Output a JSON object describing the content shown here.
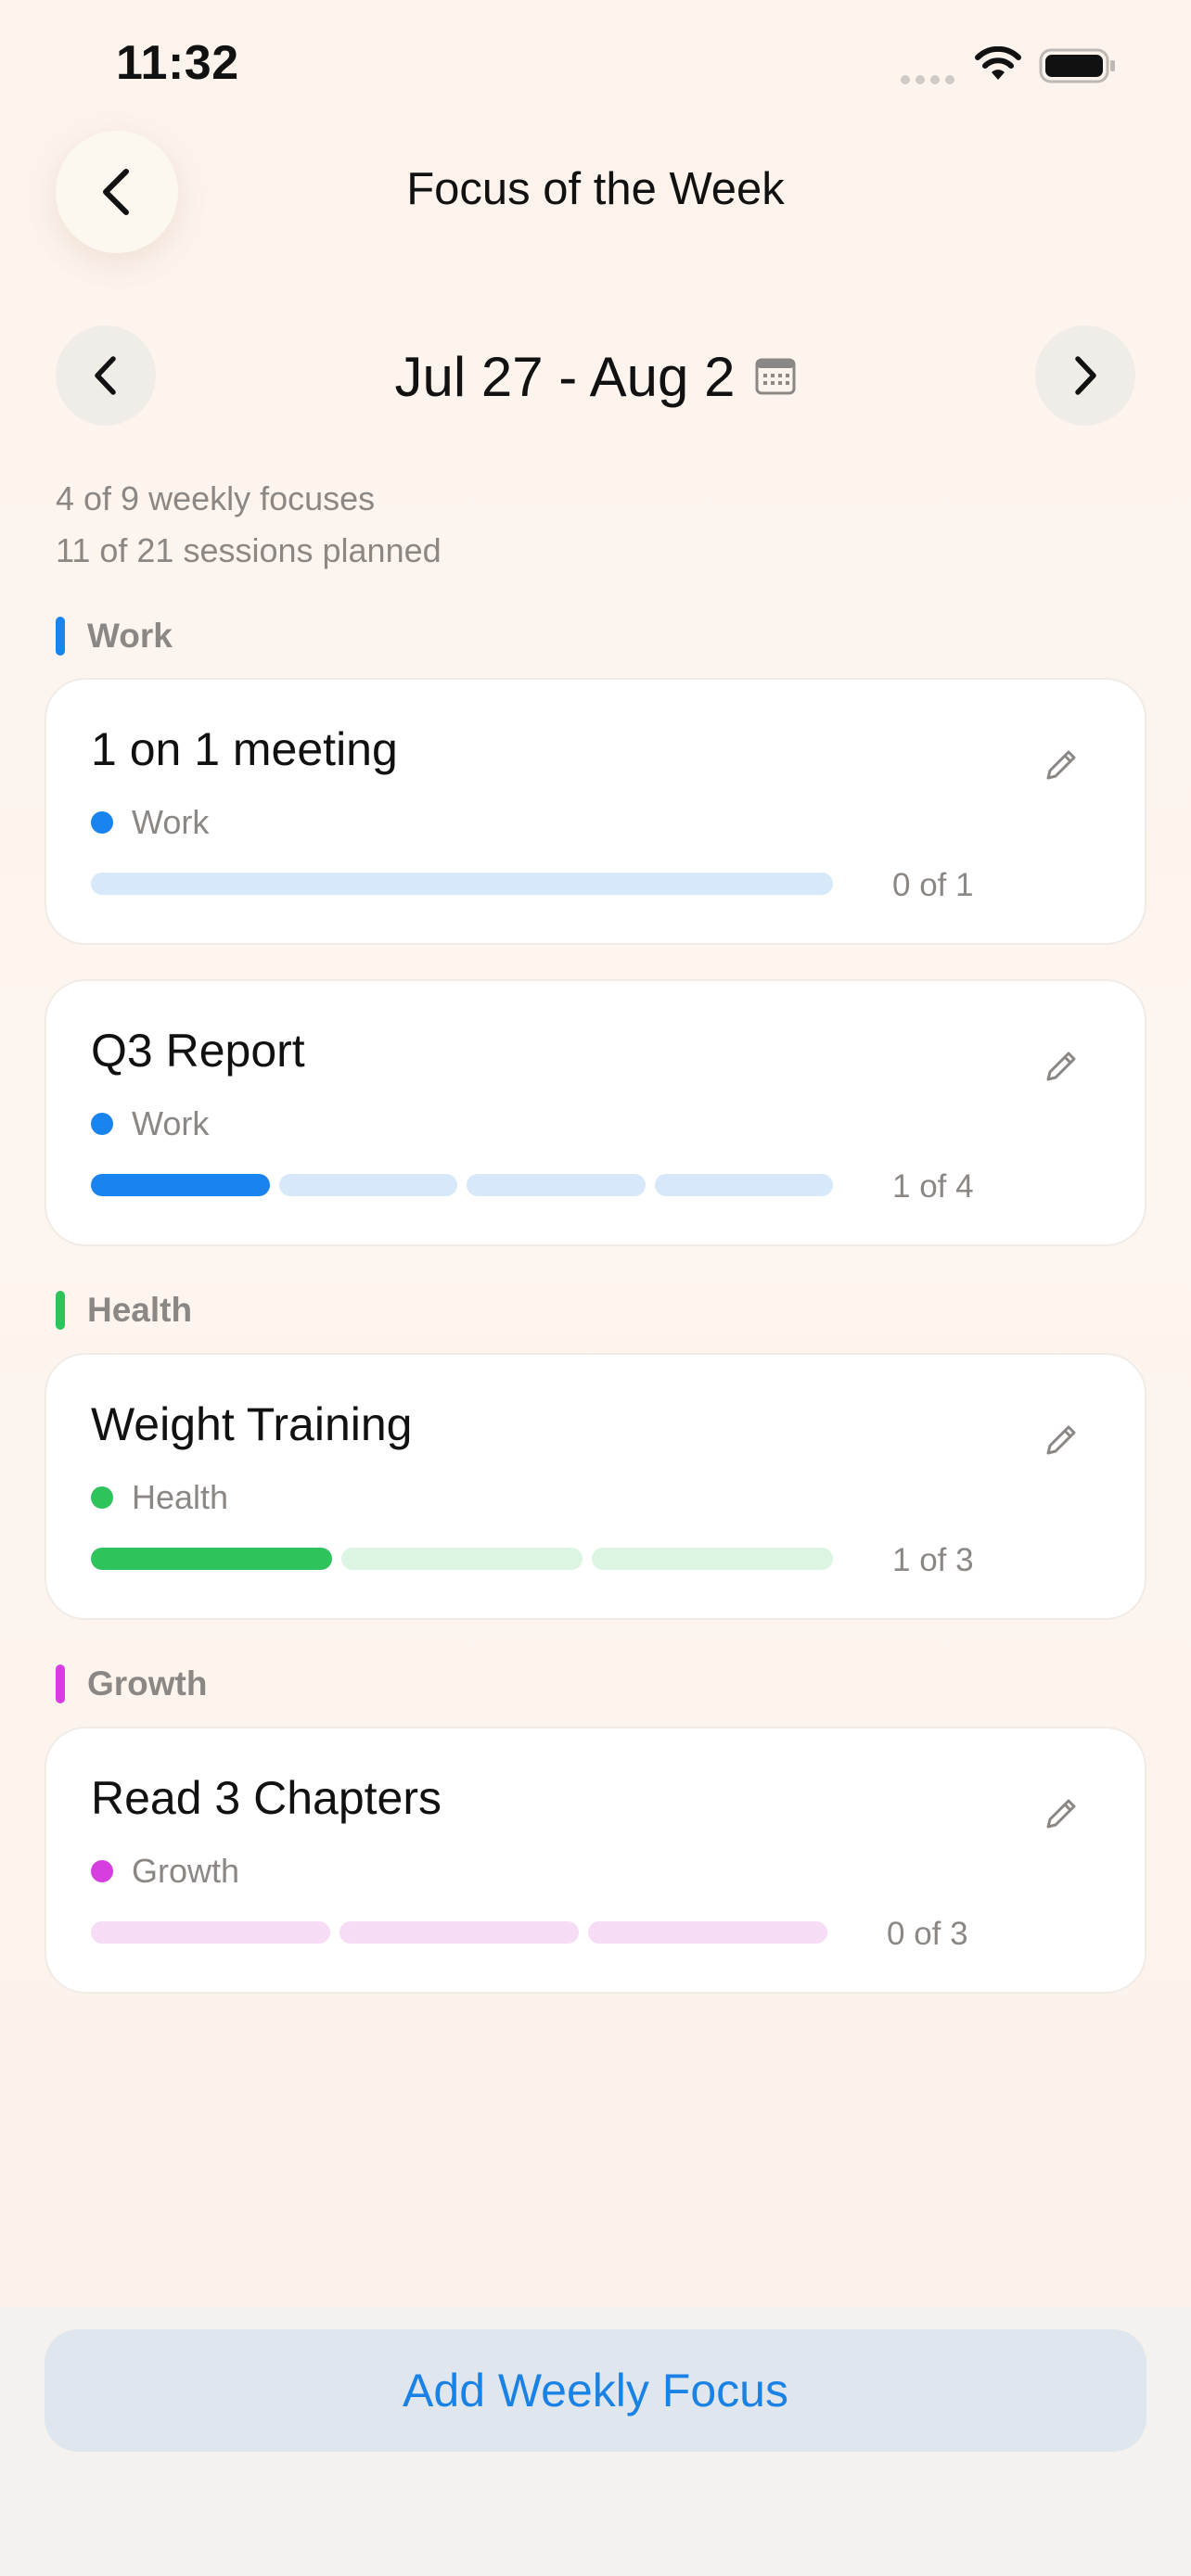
{
  "status_bar": {
    "time": "11:32"
  },
  "header": {
    "title": "Focus of the Week",
    "back_icon": "chevron-left-icon"
  },
  "week_nav": {
    "range": "Jul 27 - Aug 2",
    "prev_icon": "chevron-left-icon",
    "next_icon": "chevron-right-icon",
    "calendar_icon": "calendar-icon"
  },
  "summary": {
    "focuses": "4 of 9 weekly focuses",
    "sessions": "11 of 21 sessions planned"
  },
  "sections": [
    {
      "label": "Work",
      "color": "#1a84ee",
      "items": [
        {
          "title": "1 on 1 meeting",
          "category": "Work",
          "completed": 0,
          "total": 1,
          "progress_text": "0 of 1"
        },
        {
          "title": "Q3 Report",
          "category": "Work",
          "completed": 1,
          "total": 4,
          "progress_text": "1 of 4"
        }
      ]
    },
    {
      "label": "Health",
      "color": "#2fc35b",
      "items": [
        {
          "title": "Weight Training",
          "category": "Health",
          "completed": 1,
          "total": 3,
          "progress_text": "1 of 3"
        }
      ]
    },
    {
      "label": "Growth",
      "color": "#d63ee0",
      "items": [
        {
          "title": "Read 3 Chapters",
          "category": "Growth",
          "completed": 0,
          "total": 3,
          "progress_text": "0 of 3"
        }
      ]
    }
  ],
  "colors": {
    "work_light": "#d6e8fa",
    "health_light": "#dbf5e2",
    "growth_light": "#f7dcf6",
    "add_button_text": "#1a82e4"
  },
  "footer": {
    "add_button_label": "Add Weekly Focus"
  }
}
